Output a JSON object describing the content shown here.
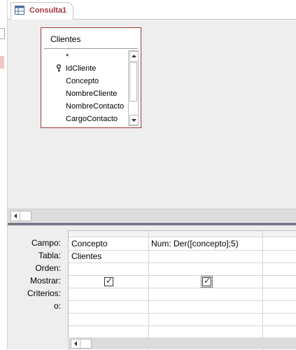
{
  "tab": {
    "label": "Consulta1",
    "icon": "query-design-icon"
  },
  "table": {
    "name": "Clientes",
    "fields": [
      "*",
      "IdCliente",
      "Concepto",
      "NombreCliente",
      "NombreContacto",
      "CargoContacto"
    ],
    "primary_key": "IdCliente"
  },
  "grid": {
    "row_labels": [
      "Campo:",
      "Tabla:",
      "Orden:",
      "Mostrar:",
      "Criterios:",
      "o:"
    ],
    "columns": [
      {
        "campo": "Concepto",
        "tabla": "Clientes",
        "orden": "",
        "mostrar": true,
        "criterios": "",
        "o": ""
      },
      {
        "campo": "Num: Der([concepto];5)",
        "tabla": "",
        "orden": "",
        "mostrar": true,
        "criterios": "",
        "o": ""
      }
    ]
  },
  "colors": {
    "accent": "#a4373a",
    "splitter": "#767c8a",
    "background": "#eeeeee"
  }
}
